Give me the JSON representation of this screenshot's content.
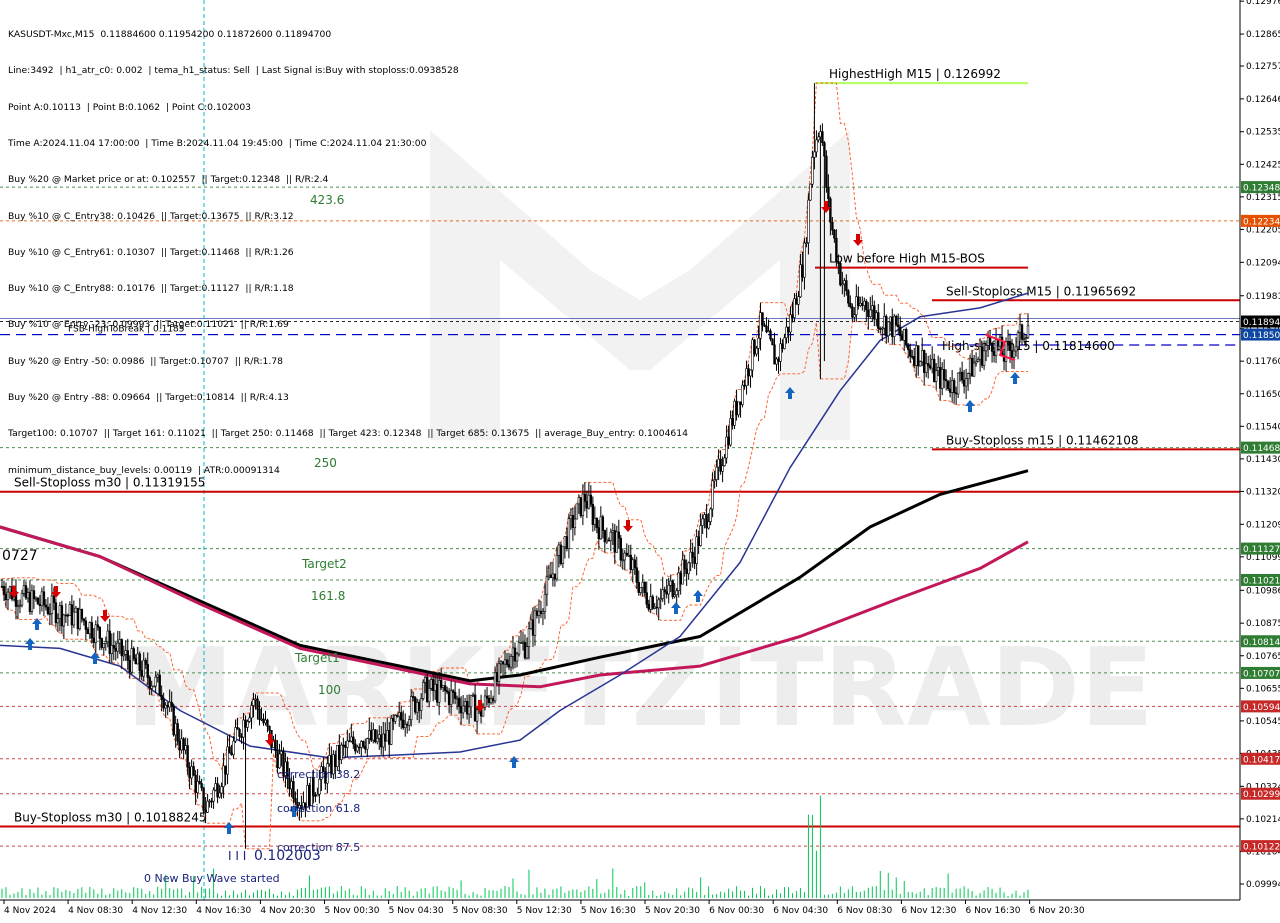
{
  "info": {
    "lines": [
      "KASUSDT-Mxc,M15  0.11884600 0.11954200 0.11872600 0.11894700",
      "Line:3492  | h1_atr_c0: 0.002  | tema_h1_status: Sell  | Last Signal is:Buy with stoploss:0.0938528",
      "Point A:0.10113  | Point B:0.1062  | Point C:0.102003",
      "Time A:2024.11.04 17:00:00  | Time B:2024.11.04 19:45:00  | Time C:2024.11.04 21:30:00",
      "Buy %20 @ Market price or at: 0.102557  || Target:0.12348  || R/R:2.4",
      "Buy %10 @ C_Entry38: 0.10426  || Target:0.13675  || R/R:3.12",
      "Buy %10 @ C_Entry61: 0.10307  || Target:0.11468  || R/R:1.26",
      "Buy %10 @ C_Entry88: 0.10176  || Target:0.11127  || R/R:1.18",
      "Buy %10 @ Entry -23: 0.09993  || Target:0.11021  || R/R:1.69",
      "Buy %20 @ Entry -50: 0.0986  || Target:0.10707  || R/R:1.78",
      "Buy %20 @ Entry -88: 0.09664  || Target:0.10814  || R/R:4.13",
      "Target100: 0.10707  || Target 161: 0.11021  || Target 250: 0.11468  || Target 423: 0.12348  || Target 685: 0.13675  || average_Buy_entry: 0.1004614",
      "minimum_distance_buy_levels: 0.00119  | ATR:0.00091314"
    ]
  },
  "colors": {
    "green_line": "#2e7d32",
    "red_line": "#cc0000",
    "blue_line": "#1a237e",
    "dashed_blue": "#0000cc",
    "ma_black": "#000000",
    "ma_red": "#c2185b",
    "ma_blue": "#283593",
    "envelope": "#ff5722",
    "candle": "#000000",
    "volume": "#00c853",
    "buy_arrow": "#1565c0",
    "sell_arrow": "#d50000"
  },
  "watermark": {
    "text": "MARKETZITRADE"
  },
  "chart_data": {
    "type": "candlestick",
    "symbol": "KASUSDT-Mxc",
    "timeframe": "M15",
    "ylim": [
      0.0994,
      0.1298
    ],
    "y_ticks": [
      "0.12976",
      "0.12865",
      "0.12757",
      "0.12646",
      "0.12535",
      "0.12425",
      "0.12315",
      "0.12205",
      "0.12094",
      "0.11981",
      "0.11870",
      "0.11760",
      "0.11650",
      "0.11540",
      "0.11430",
      "0.11320",
      "0.11209",
      "0.11099",
      "0.10986",
      "0.10875",
      "0.10765",
      "0.10655",
      "0.10545",
      "0.10435",
      "0.10324",
      "0.10214",
      "0.10104",
      "0.09994"
    ],
    "x_ticks": [
      "4 Nov 2024",
      "4 Nov 08:30",
      "4 Nov 12:30",
      "4 Nov 16:30",
      "4 Nov 20:30",
      "5 Nov 00:30",
      "5 Nov 04:30",
      "5 Nov 08:30",
      "5 Nov 12:30",
      "5 Nov 16:30",
      "5 Nov 20:30",
      "6 Nov 00:30",
      "6 Nov 04:30",
      "6 Nov 08:30",
      "6 Nov 12:30",
      "6 Nov 16:30",
      "6 Nov 20:30"
    ],
    "price_tags": [
      {
        "value": "0.12348",
        "price": 0.12348,
        "color": "#2e7d32"
      },
      {
        "value": "0.12234",
        "price": 0.12234,
        "color": "#e65100"
      },
      {
        "value": "0.11894",
        "price": 0.11894,
        "color": "#000000"
      },
      {
        "value": "0.11850",
        "price": 0.1185,
        "color": "#0d47a1"
      },
      {
        "value": "0.11468",
        "price": 0.11468,
        "color": "#2e7d32"
      },
      {
        "value": "0.11127",
        "price": 0.11127,
        "color": "#2e7d32"
      },
      {
        "value": "0.11021",
        "price": 0.11021,
        "color": "#2e7d32"
      },
      {
        "value": "0.10814",
        "price": 0.10814,
        "color": "#2e7d32"
      },
      {
        "value": "0.10707",
        "price": 0.10707,
        "color": "#2e7d32"
      },
      {
        "value": "0.10594",
        "price": 0.10594,
        "color": "#c62828"
      },
      {
        "value": "0.10417",
        "price": 0.10417,
        "color": "#c62828"
      },
      {
        "value": "0.10299",
        "price": 0.10299,
        "color": "#c62828"
      },
      {
        "value": "0.10122",
        "price": 0.10122,
        "color": "#c62828"
      }
    ],
    "levels": [
      {
        "label": "HighestHigh   M15 | 0.126992",
        "price": 0.126992,
        "color": "#76ff03",
        "x_start": 0.63
      },
      {
        "label": "Low before High   M15-BOS",
        "price": 0.12076,
        "color": "#cc0000",
        "x_start": 0.64
      },
      {
        "label": "Sell-Stoploss M15 | 0.11965692",
        "price": 0.11965692,
        "color": "#cc0000",
        "x_start": 0.73
      },
      {
        "label": "High-shift m15 | 0.11814600",
        "price": 0.118146,
        "color": "#000000",
        "x_start": 0.73
      },
      {
        "label": "Buy-Stoploss m15 | 0.11462108",
        "price": 0.11462108,
        "color": "#cc0000",
        "x_start": 0.73
      },
      {
        "label": "Sell-Stoploss m30 | 0.11319155",
        "price": 0.11319155,
        "color": "#cc0000",
        "x_start": 0.0
      },
      {
        "label": "Buy-Stoploss m30 | 0.10188245",
        "price": 0.10188245,
        "color": "#cc0000",
        "x_start": 0.0
      },
      {
        "label": "FSB-HighToBreak | 0.1185",
        "price": 0.1185,
        "color": "#0000cc",
        "x_start": 0.0
      }
    ],
    "fib_labels": [
      "423.6",
      "250",
      "Target2",
      "161.8",
      "Target1",
      "100"
    ],
    "annotations": [
      "0727",
      "correction 38.2",
      "correction 61.8",
      "correction 87.5",
      "0.102003",
      "0 New Buy Wave started"
    ]
  }
}
